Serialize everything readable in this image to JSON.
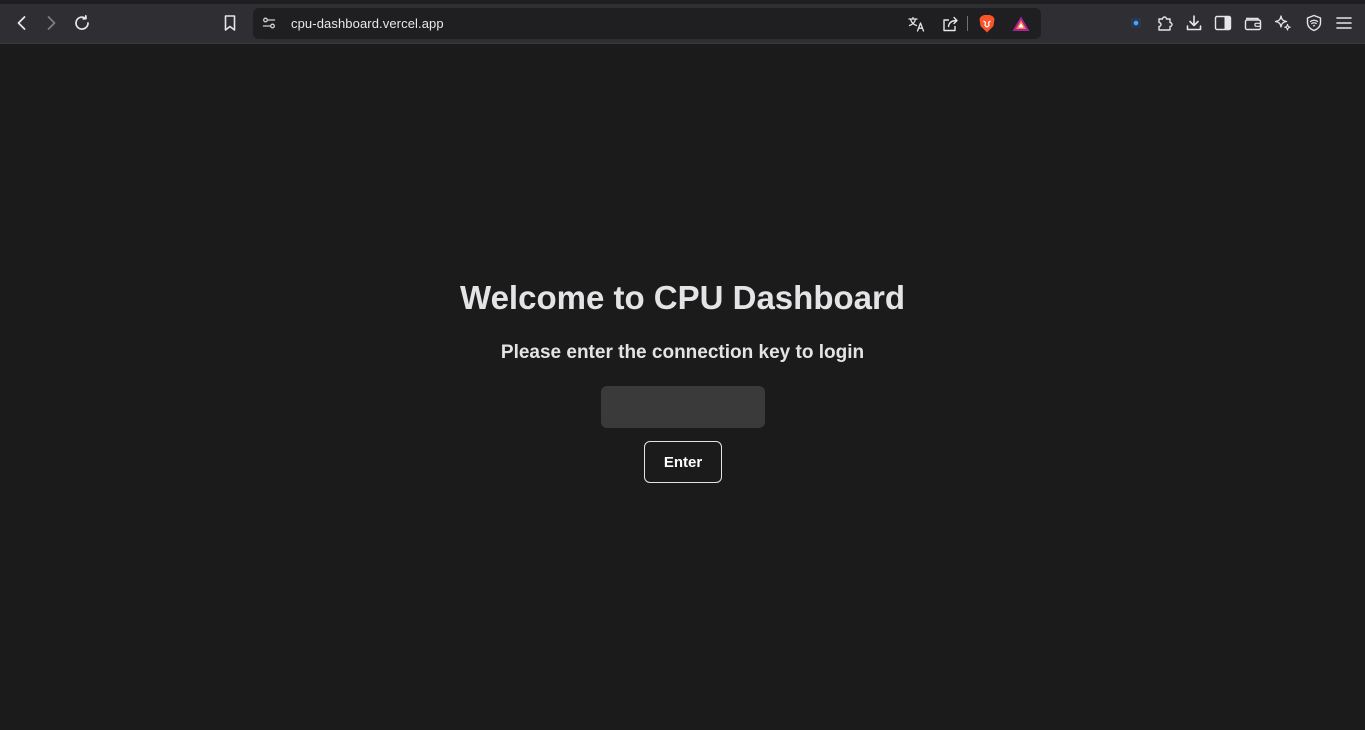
{
  "browser": {
    "url": "cpu-dashboard.vercel.app",
    "icons": {
      "back": "chevron-left-icon",
      "forward": "chevron-right-icon",
      "reload": "reload-icon",
      "bookmark": "bookmark-icon",
      "site_settings": "site-settings-icon",
      "translate": "translate-icon",
      "share": "share-icon",
      "brave_shields": "brave-lion-icon",
      "brave_rewards": "brave-rewards-triangle-icon",
      "extension_pin": "extension-icon",
      "extensions": "puzzle-icon",
      "downloads": "download-icon",
      "sidebar": "sidebar-icon",
      "wallet": "wallet-icon",
      "leo_ai": "sparkle-icon",
      "vpn": "vpn-shield-icon",
      "menu": "hamburger-menu-icon"
    },
    "colors": {
      "toolbar": "#2f2f33",
      "addressbar": "#1f1f22",
      "brave_orange": "#fb542b",
      "rewards_purple": "#a1249b"
    }
  },
  "page": {
    "title": "Welcome to CPU Dashboard",
    "subtitle": "Please enter the connection key to login",
    "key_input": {
      "value": "",
      "placeholder": ""
    },
    "enter_button_label": "Enter",
    "colors": {
      "background": "#1b1b1c",
      "text": "#e4e4e6",
      "input_background": "#3a3a3b"
    }
  }
}
